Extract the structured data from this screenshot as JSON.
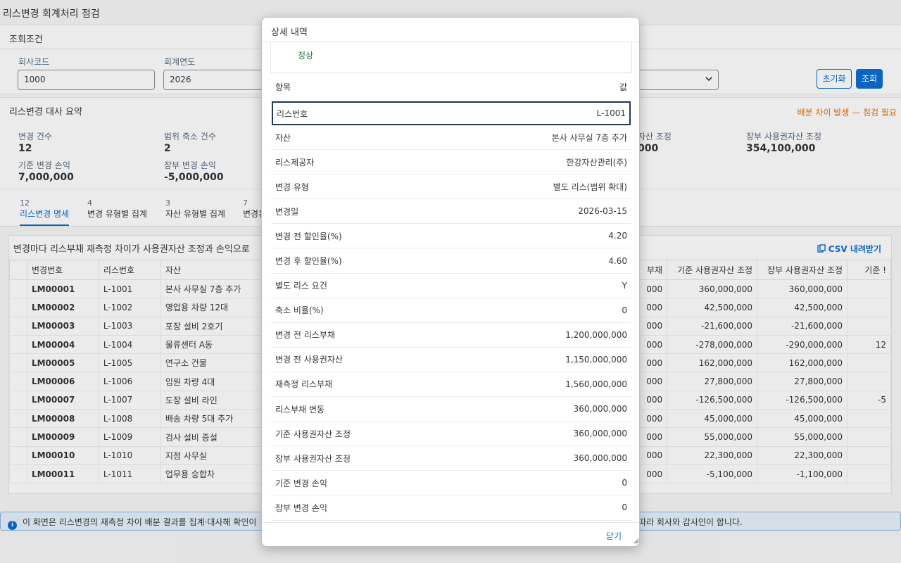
{
  "page": {
    "title": "리스변경 회계처리 점검"
  },
  "filter": {
    "title": "조회조건",
    "company_label": "회사코드",
    "company_value": "1000",
    "year_label": "회계연도",
    "year_value": "2026",
    "reset_label": "초기화",
    "search_label": "조회"
  },
  "summary": {
    "title": "리스변경 대사 요약",
    "warning": "배분 차이 발생 — 점검 필요",
    "kpis": [
      {
        "label": "변경 건수",
        "value": "12"
      },
      {
        "label": "범위 축소 건수",
        "value": "2"
      },
      {
        "label": "기준 변경 손익",
        "value": "7,000,000"
      },
      {
        "label": "장부 변경 손익",
        "value": "-5,000,000"
      },
      {
        "label": "자산 조정",
        "value": "000"
      },
      {
        "label": "장부 사용권자산 조정",
        "value": "354,100,000"
      }
    ]
  },
  "tabs": [
    {
      "count": "12",
      "label": "리스변경 명세"
    },
    {
      "count": "4",
      "label": "변경 유형별 집계"
    },
    {
      "count": "3",
      "label": "자산 유형별 집계"
    },
    {
      "count": "7",
      "label": "변경유"
    }
  ],
  "table": {
    "caption": "변경마다 리스부채 재측정 차이가 사용권자산 조정과 손익으로",
    "csv_label": "CSV 내려받기",
    "columns": [
      "변경번호",
      "리스번호",
      "자산",
      "부채",
      "기준 사용권자산 조정",
      "장부 사용권자산 조정",
      "기준 !"
    ],
    "rows": [
      [
        "LM00001",
        "L-1001",
        "본사 사무실 7층 추가",
        "000",
        "360,000,000",
        "360,000,000",
        ""
      ],
      [
        "LM00002",
        "L-1002",
        "영업용 차량 12대",
        "000",
        "42,500,000",
        "42,500,000",
        ""
      ],
      [
        "LM00003",
        "L-1003",
        "포장 설비 2호기",
        "000",
        "-21,600,000",
        "-21,600,000",
        ""
      ],
      [
        "LM00004",
        "L-1004",
        "물류센터 A동",
        "000",
        "-278,000,000",
        "-290,000,000",
        "12"
      ],
      [
        "LM00005",
        "L-1005",
        "연구소 건물",
        "000",
        "162,000,000",
        "162,000,000",
        ""
      ],
      [
        "LM00006",
        "L-1006",
        "임원 차량 4대",
        "000",
        "27,800,000",
        "27,800,000",
        ""
      ],
      [
        "LM00007",
        "L-1007",
        "도장 설비 라인",
        "000",
        "-126,500,000",
        "-126,500,000",
        "-5"
      ],
      [
        "LM00008",
        "L-1008",
        "배송 차량 5대 추가",
        "000",
        "45,000,000",
        "45,000,000",
        ""
      ],
      [
        "LM00009",
        "L-1009",
        "검사 설비 증설",
        "000",
        "55,000,000",
        "55,000,000",
        ""
      ],
      [
        "LM00010",
        "L-1010",
        "지점 사무실",
        "000",
        "22,300,000",
        "22,300,000",
        ""
      ],
      [
        "LM00011",
        "L-1011",
        "업무용 승합차",
        "000",
        "-5,100,000",
        "-1,100,000",
        ""
      ]
    ]
  },
  "info": {
    "text": "이 화면은 리스변경의 재측정 차이 배분 결과를 집계·대사해 확인이",
    "tail": "따라 회사와 감사인이 합니다."
  },
  "dialog": {
    "title": "상세 내역",
    "status": "정상",
    "header_key": "항목",
    "header_val": "값",
    "rows": [
      {
        "k": "리스번호",
        "v": "L-1001"
      },
      {
        "k": "자산",
        "v": "본사 사무실 7층 추가"
      },
      {
        "k": "리스제공자",
        "v": "한강자산관리(주)"
      },
      {
        "k": "변경 유형",
        "v": "별도 리스(범위 확대)"
      },
      {
        "k": "변경일",
        "v": "2026-03-15"
      },
      {
        "k": "변경 전 할인율(%)",
        "v": "4.20"
      },
      {
        "k": "변경 후 할인율(%)",
        "v": "4.60"
      },
      {
        "k": "별도 리스 요건",
        "v": "Y"
      },
      {
        "k": "축소 비율(%)",
        "v": "0"
      },
      {
        "k": "변경 전 리스부채",
        "v": "1,200,000,000"
      },
      {
        "k": "변경 전 사용권자산",
        "v": "1,150,000,000"
      },
      {
        "k": "재측정 리스부채",
        "v": "1,560,000,000"
      },
      {
        "k": "리스부채 변동",
        "v": "360,000,000"
      },
      {
        "k": "기준 사용권자산 조정",
        "v": "360,000,000"
      },
      {
        "k": "장부 사용권자산 조정",
        "v": "360,000,000"
      },
      {
        "k": "기준 변경 손익",
        "v": "0"
      },
      {
        "k": "장부 변경 손익",
        "v": "0"
      }
    ],
    "close_label": "닫기"
  }
}
